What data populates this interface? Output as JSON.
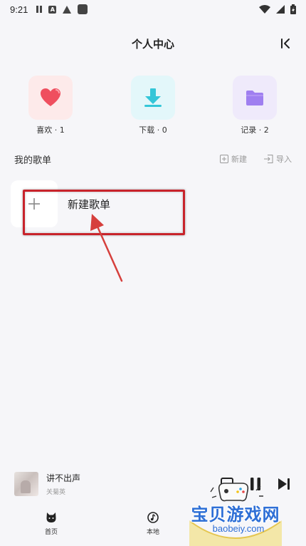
{
  "status_bar": {
    "time": "9:21",
    "left_icons": [
      "pause-icon",
      "a-icon",
      "warning-icon",
      "square-icon"
    ],
    "right_icons": [
      "wifi-icon",
      "signal-icon",
      "battery-icon"
    ]
  },
  "header": {
    "title": "个人中心",
    "collapse_icon": "collapse-left-icon"
  },
  "quick_access": [
    {
      "label": "喜欢 · 1",
      "icon": "heart-icon",
      "tile_color": "#fdeaea",
      "icon_color": "#ef4f5f"
    },
    {
      "label": "下载 · 0",
      "icon": "download-icon",
      "tile_color": "#e3f7fa",
      "icon_color": "#34c6d8"
    },
    {
      "label": "记录 · 2",
      "icon": "folder-icon",
      "tile_color": "#efeafb",
      "icon_color": "#9f7ff0"
    }
  ],
  "playlists": {
    "title": "我的歌单",
    "new_label": "新建",
    "import_label": "导入",
    "new_playlist_label": "新建歌单"
  },
  "annotation": {
    "color": "#c8232b"
  },
  "player": {
    "song_title": "讲不出声",
    "artist": "关菊英"
  },
  "nav": [
    {
      "label": "首页",
      "icon": "cat-icon"
    },
    {
      "label": "本地",
      "icon": "music-note-icon"
    }
  ],
  "watermark": {
    "text": "宝贝游戏网",
    "url": "baobeiy.com"
  }
}
